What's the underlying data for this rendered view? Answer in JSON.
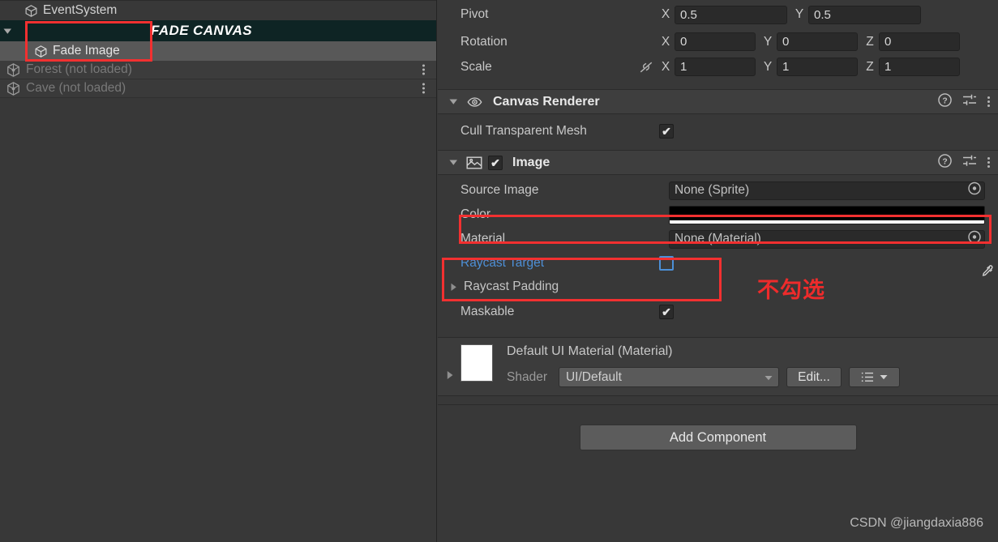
{
  "hierarchy": {
    "rows": [
      {
        "label": "EventSystem",
        "icon": "gameobject-cube-icon",
        "state": "normal",
        "indent": 1,
        "has_foldout": false,
        "has_menu": false
      },
      {
        "label": "FADE CANVAS",
        "icon": "none",
        "state": "canvas-banner",
        "indent": 0,
        "has_foldout": true,
        "has_menu": false
      },
      {
        "label": "Fade Image",
        "icon": "gameobject-cube-icon",
        "state": "selected",
        "indent": 2,
        "has_foldout": false,
        "has_menu": false
      },
      {
        "label": "Forest (not loaded)",
        "icon": "unity-scene-icon",
        "state": "not-loaded",
        "indent": 0,
        "has_foldout": false,
        "has_menu": true
      },
      {
        "label": "Cave (not loaded)",
        "icon": "unity-scene-icon",
        "state": "not-loaded",
        "indent": 0,
        "has_foldout": false,
        "has_menu": true
      }
    ]
  },
  "inspector": {
    "transform": {
      "pivot": {
        "label": "Pivot",
        "x_axis": "X",
        "x": "0.5",
        "y_axis": "Y",
        "y": "0.5"
      },
      "rotation": {
        "label": "Rotation",
        "x_axis": "X",
        "x": "0",
        "y_axis": "Y",
        "y": "0",
        "z_axis": "Z",
        "z": "0"
      },
      "scale": {
        "label": "Scale",
        "constrain_icon": "link-off-icon",
        "x_axis": "X",
        "x": "1",
        "y_axis": "Y",
        "y": "1",
        "z_axis": "Z",
        "z": "1"
      }
    },
    "canvas_renderer": {
      "title": "Canvas Renderer",
      "icon": "eye-icon",
      "cull_transparent_mesh": {
        "label": "Cull Transparent Mesh",
        "checked": true
      }
    },
    "image": {
      "title": "Image",
      "icon": "sprite-image-icon",
      "enabled": true,
      "source_image": {
        "label": "Source Image",
        "value": "None (Sprite)"
      },
      "color": {
        "label": "Color",
        "value": "#000000",
        "alpha_bar": "#FFFFFF"
      },
      "material": {
        "label": "Material",
        "value": "None (Material)"
      },
      "raycast_target": {
        "label": "Raycast Target",
        "checked": false,
        "highlighted": true
      },
      "raycast_padding": {
        "label": "Raycast Padding"
      },
      "maskable": {
        "label": "Maskable",
        "checked": true
      }
    },
    "material_block": {
      "title": "Default UI Material (Material)",
      "shader_label": "Shader",
      "shader_value": "UI/Default",
      "edit_button": "Edit...",
      "preview_color": "#FFFFFF"
    },
    "add_component": "Add Component"
  },
  "annotations": {
    "note_text": "不勾选",
    "accent_color": "#F23030"
  },
  "watermark": "CSDN @jiangdaxia886"
}
